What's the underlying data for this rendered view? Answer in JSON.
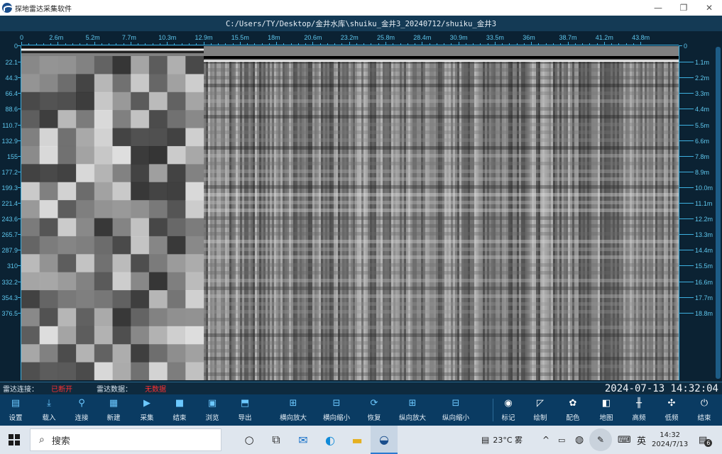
{
  "window": {
    "title": "探地雷达采集软件",
    "minimize_glyph": "—",
    "maximize_glyph": "❐",
    "close_glyph": "✕"
  },
  "path": "C:/Users/TY/Desktop/金井水库\\shuiku_金井3_20240712/shuiku_金井3",
  "axes": {
    "top_ticks": [
      "0",
      "2.6m",
      "5.2m",
      "7.7m",
      "10.3m",
      "12.9m",
      "15.5m",
      "18m",
      "20.6m",
      "23.2m",
      "25.8m",
      "28.4m",
      "30.9m",
      "33.5m",
      "36m",
      "38.7m",
      "41.2m",
      "43.8m"
    ],
    "left_ticks": [
      "0",
      "22.1",
      "44.3",
      "66.4",
      "88.6",
      "110.7",
      "132.9",
      "155",
      "177.2",
      "199.3",
      "221.4",
      "243.6",
      "265.7",
      "287.9",
      "310",
      "332.2",
      "354.3",
      "376.5"
    ],
    "right_ticks": [
      "0",
      "1.1m",
      "2.2m",
      "3.3m",
      "4.4m",
      "5.5m",
      "6.6m",
      "7.8m",
      "8.9m",
      "10.0m",
      "11.1m",
      "12.2m",
      "13.3m",
      "14.4m",
      "15.5m",
      "16.6m",
      "17.7m",
      "18.8m"
    ]
  },
  "status": {
    "radar_connection_label": "雷达连接：",
    "radar_connection_value": "已断开",
    "radar_data_label": "雷达数据：",
    "radar_data_value": "无数据",
    "datetime": "2024-07-13 14:32:04",
    "value_color": "#ff3030"
  },
  "toolbar": [
    {
      "label": "设置",
      "icon": "settings-doc-icon",
      "glyph": "▤"
    },
    {
      "label": "载入",
      "icon": "download-icon",
      "glyph": "⤓"
    },
    {
      "label": "连接",
      "icon": "link-icon",
      "glyph": "⚲"
    },
    {
      "label": "新建",
      "icon": "new-file-icon",
      "glyph": "▦"
    },
    {
      "label": "采集",
      "icon": "play-icon",
      "glyph": "▶"
    },
    {
      "label": "结束",
      "icon": "stop-icon",
      "glyph": "■"
    },
    {
      "label": "浏览",
      "icon": "image-icon",
      "glyph": "▣"
    },
    {
      "label": "导出",
      "icon": "export-icon",
      "glyph": "⬒"
    },
    {
      "label": "横向放大",
      "icon": "h-zoom-in-icon",
      "glyph": "⊞"
    },
    {
      "label": "横向缩小",
      "icon": "h-zoom-out-icon",
      "glyph": "⊟"
    },
    {
      "label": "恢复",
      "icon": "refresh-icon",
      "glyph": "⟳"
    },
    {
      "label": "纵向放大",
      "icon": "v-zoom-in-icon",
      "glyph": "⊞"
    },
    {
      "label": "纵向缩小",
      "icon": "v-zoom-out-icon",
      "glyph": "⊟"
    },
    {
      "label": "标记",
      "icon": "mark-icon",
      "glyph": "◉"
    },
    {
      "label": "绘制",
      "icon": "draw-icon",
      "glyph": "◸"
    },
    {
      "label": "配色",
      "icon": "palette-icon",
      "glyph": "✿"
    },
    {
      "label": "地图",
      "icon": "map-icon",
      "glyph": "◧"
    },
    {
      "label": "高频",
      "icon": "high-freq-icon",
      "glyph": "╫"
    },
    {
      "label": "低频",
      "icon": "low-freq-icon",
      "glyph": "✣"
    },
    {
      "label": "结束",
      "icon": "power-icon",
      "glyph": "⏻"
    }
  ],
  "taskbar": {
    "search_placeholder": "搜索",
    "weather": "23°C 雾",
    "ime": "英",
    "time": "14:32",
    "date": "2024/7/13",
    "notifications": "6"
  }
}
